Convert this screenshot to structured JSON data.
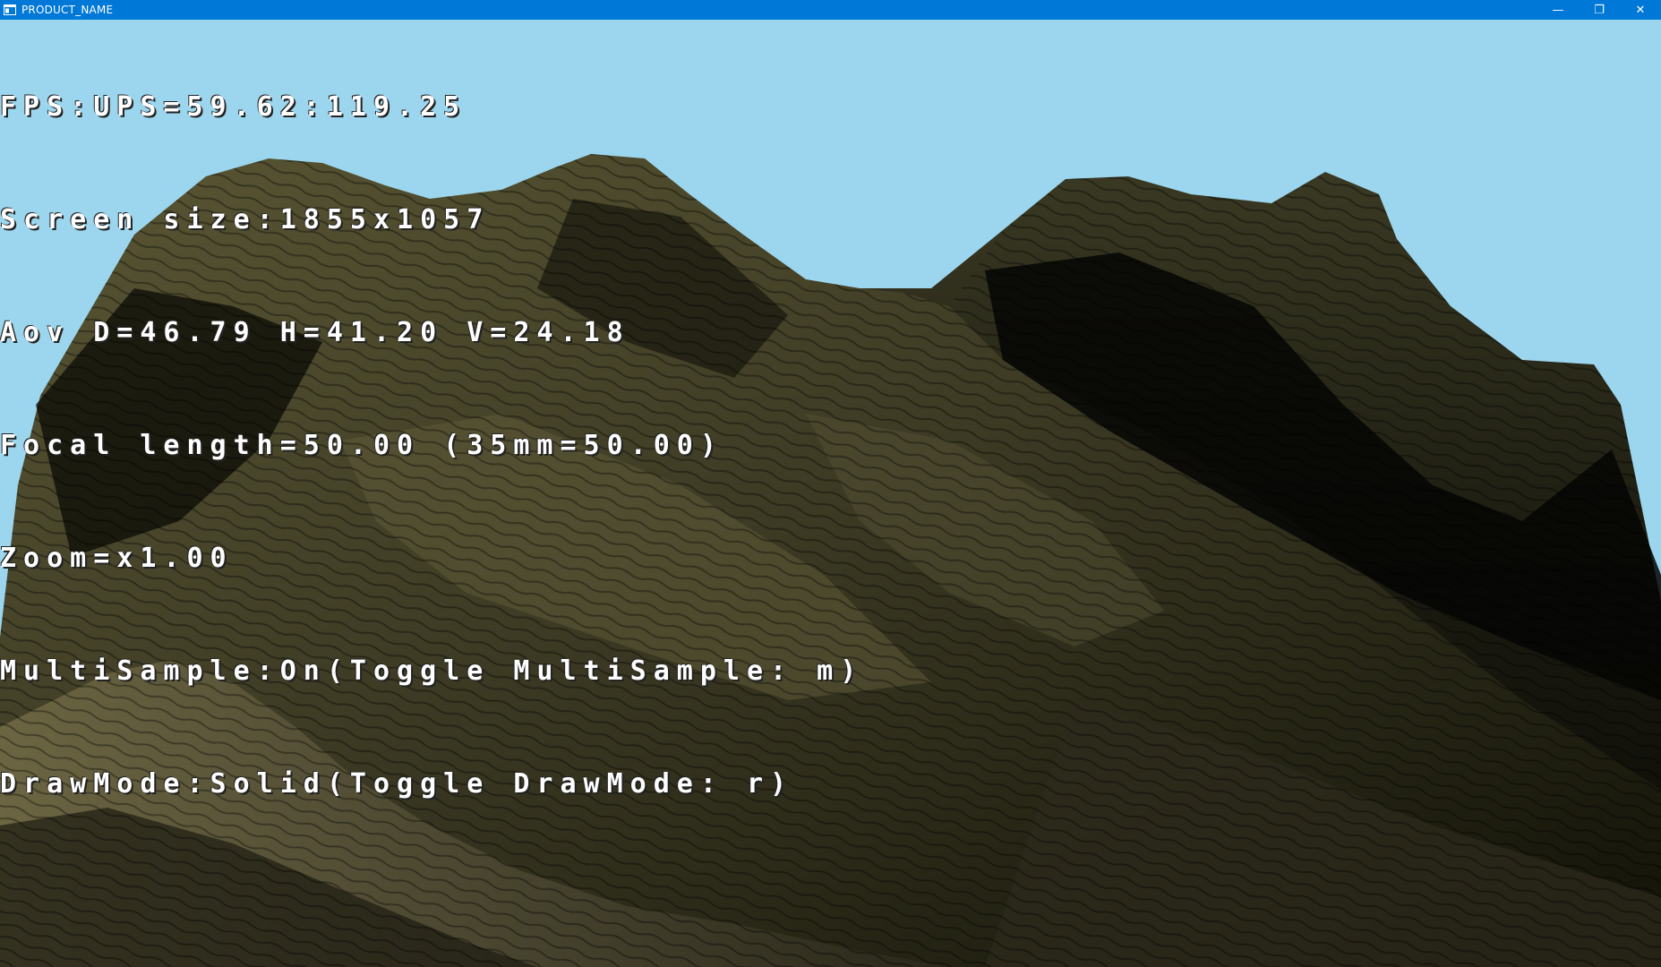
{
  "window": {
    "title": "PRODUCT_NAME",
    "controls": {
      "minimize": "—",
      "restore": "❐",
      "close": "✕"
    },
    "titlebar_color": "#0078d7"
  },
  "scene": {
    "sky_color": "#9cd6ee",
    "terrain_color": "#5a5634"
  },
  "hud": {
    "fps": "FPS:UPS=59.62:119.25",
    "screen_size": "Screen size:1855x1057",
    "aov": "Aov D=46.79 H=41.20 V=24.18",
    "focal_length": "Focal length=50.00 (35mm=50.00)",
    "zoom": "Zoom=x1.00",
    "multisample": "MultiSample:On(Toggle MultiSample: m)",
    "drawmode": "DrawMode:Solid(Toggle DrawMode: r)"
  }
}
